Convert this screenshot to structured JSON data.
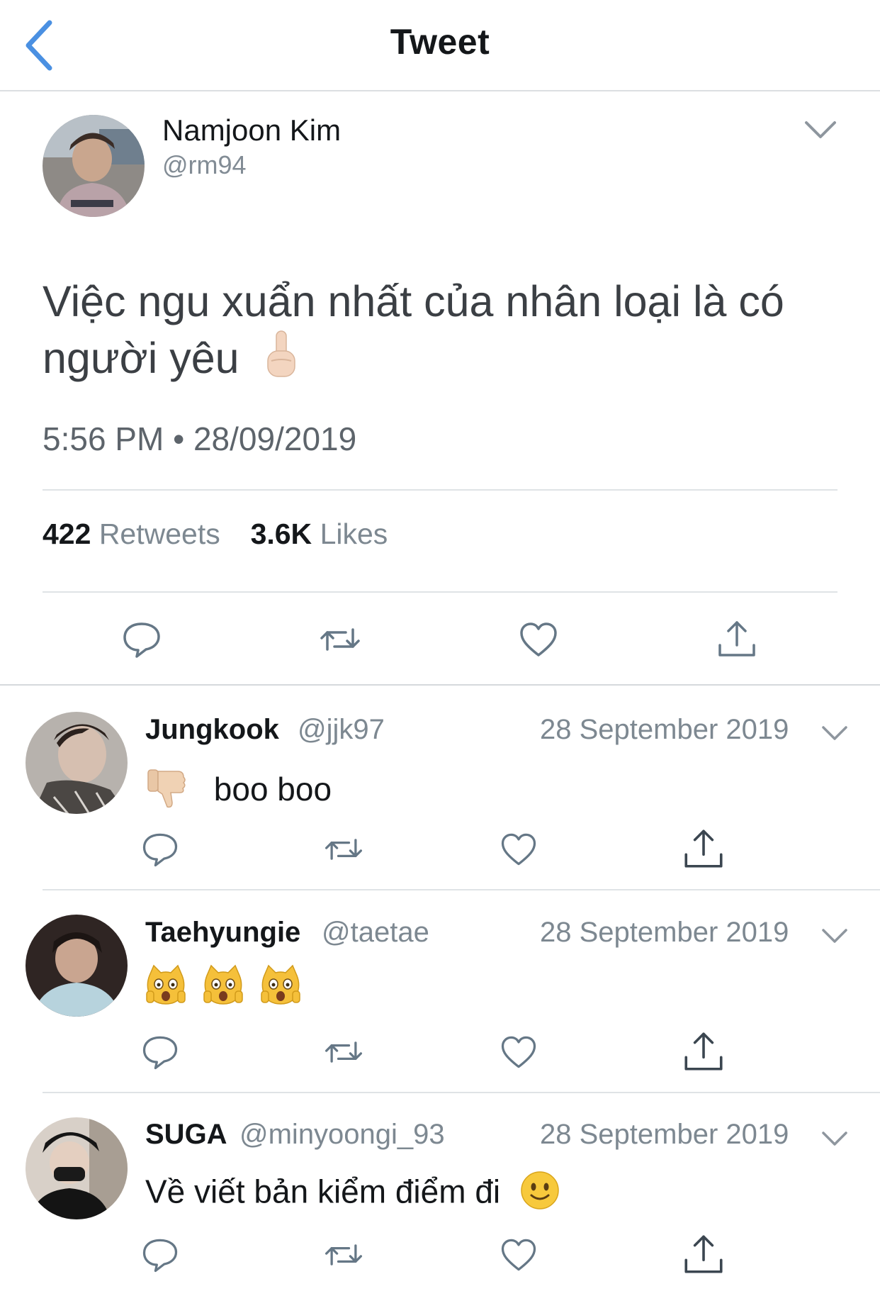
{
  "header": {
    "title": "Tweet"
  },
  "main_tweet": {
    "author_name": "Namjoon Kim",
    "author_handle": "@rm94",
    "text_line1": "Việc ngu xuẩn nhất của nhân loại là có",
    "text_line2": "người yêu",
    "timestamp": "5:56 PM • 28/09/2019",
    "retweets_count": "422",
    "retweets_label": "Retweets",
    "likes_count": "3.6K",
    "likes_label": "Likes"
  },
  "replies": [
    {
      "name": "Jungkook",
      "handle": "@jjk97",
      "date": "28 September 2019",
      "text": "boo boo"
    },
    {
      "name": "Taehyungie",
      "handle": "@taetae",
      "date": "28 September 2019",
      "text": ""
    },
    {
      "name": "SUGA",
      "handle": "@minyoongi_93",
      "date": "28 September 2019",
      "text": "Về viết bản kiểm điểm đi"
    }
  ],
  "icons": {
    "back": "chevron-left-icon",
    "menu": "chevron-down-icon",
    "reply": "comment-icon",
    "retweet": "retweet-icon",
    "like": "heart-icon",
    "share": "share-icon"
  },
  "colors": {
    "accent": "#4a90e2",
    "icon_gray": "#657786",
    "secondary_text": "#7d8891"
  }
}
